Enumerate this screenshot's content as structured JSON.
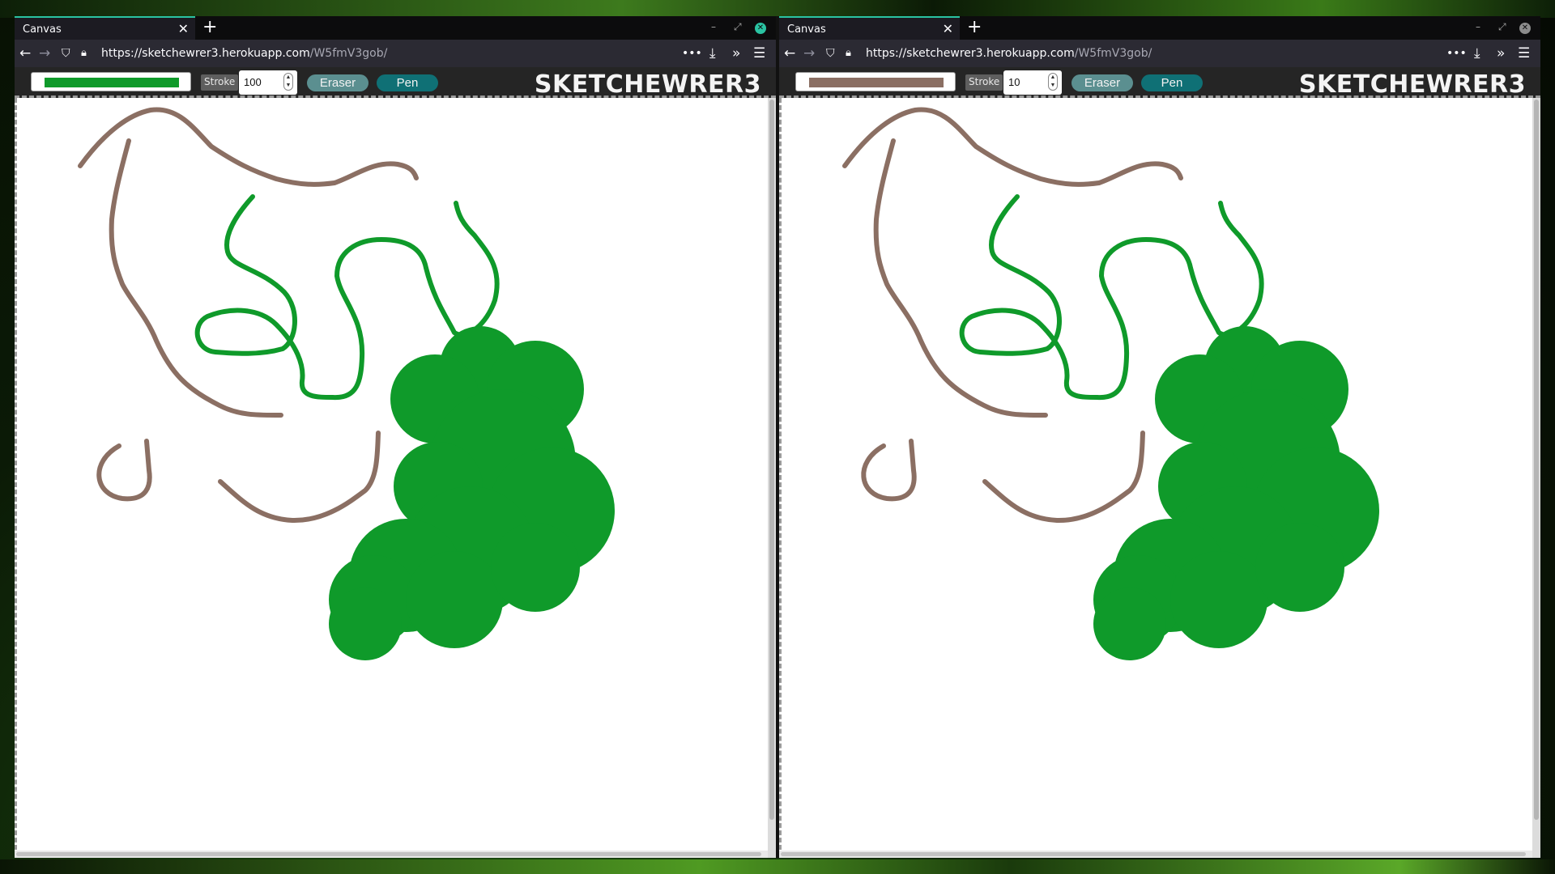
{
  "windows": [
    {
      "tab_title": "Canvas",
      "url_host": "https://sketchewrer3.herokuapp.com",
      "url_path": "/W5fmV3gob/",
      "color_swatch": "#0f9a2a",
      "stroke_label": "Stroke",
      "stroke_value": "100",
      "eraser_label": "Eraser",
      "pen_label": "Pen",
      "brand": "SKETCHEWRER3"
    },
    {
      "tab_title": "Canvas",
      "url_host": "https://sketchewrer3.herokuapp.com",
      "url_path": "/W5fmV3gob/",
      "color_swatch": "#8b6f63",
      "stroke_label": "Stroke",
      "stroke_value": "10",
      "eraser_label": "Eraser",
      "pen_label": "Pen",
      "brand": "SKETCHEWRER3"
    }
  ],
  "colors": {
    "green_ink": "#0f9a2a",
    "brown_ink": "#8b6f63",
    "accent_tab": "#2ac3a2"
  },
  "icons": {
    "back": "back-arrow-icon",
    "forward": "forward-arrow-icon",
    "shield": "shield-icon",
    "lock": "lock-icon",
    "more": "more-dots-icon",
    "download": "download-icon",
    "overflow": "chevron-double-right-icon",
    "menu": "hamburger-menu-icon"
  }
}
